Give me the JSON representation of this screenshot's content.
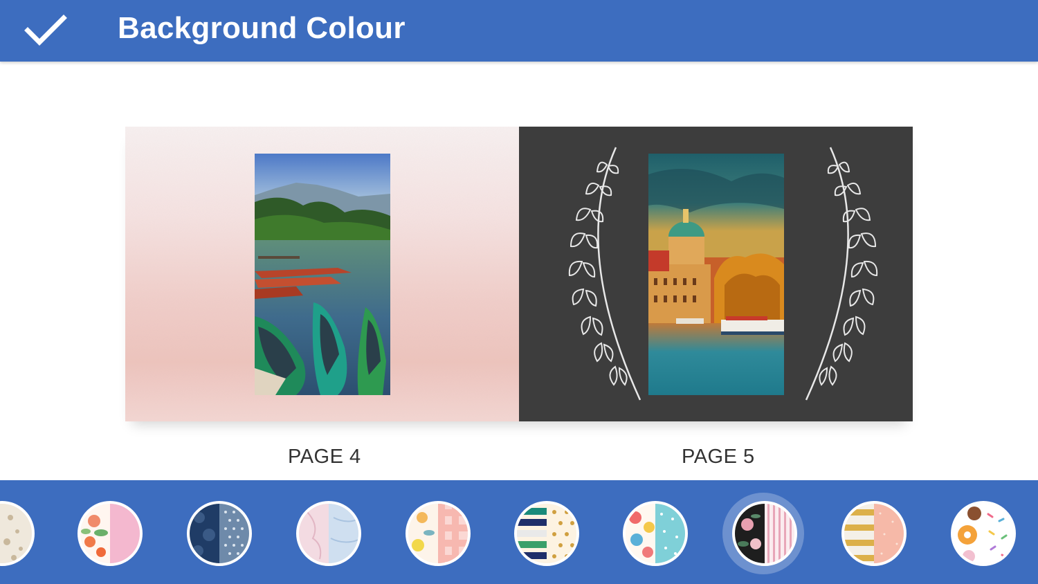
{
  "header": {
    "title": "Background Colour",
    "confirm_icon": "check-icon"
  },
  "pages": [
    {
      "label": "PAGE 4",
      "background": "pink-watercolor",
      "photo": "lake-boats-photo"
    },
    {
      "label": "PAGE 5",
      "background": "dark-chalkboard-laurel",
      "photo": "city-river-photo"
    }
  ],
  "colors": {
    "accent": "#3d6dbf",
    "text": "#333333",
    "white": "#ffffff"
  },
  "swatches": [
    {
      "name": "swatch-floral-cream",
      "selected": false
    },
    {
      "name": "swatch-pink-floral",
      "selected": false
    },
    {
      "name": "swatch-navy-dots",
      "selected": false
    },
    {
      "name": "swatch-pink-blue-marble",
      "selected": false
    },
    {
      "name": "swatch-floral-gingham",
      "selected": false
    },
    {
      "name": "swatch-stripes-dots",
      "selected": false
    },
    {
      "name": "swatch-colorful-dots",
      "selected": false
    },
    {
      "name": "swatch-dark-floral-stripes",
      "selected": true
    },
    {
      "name": "swatch-gold-peach",
      "selected": false
    },
    {
      "name": "swatch-donuts-sprinkles",
      "selected": false
    }
  ]
}
